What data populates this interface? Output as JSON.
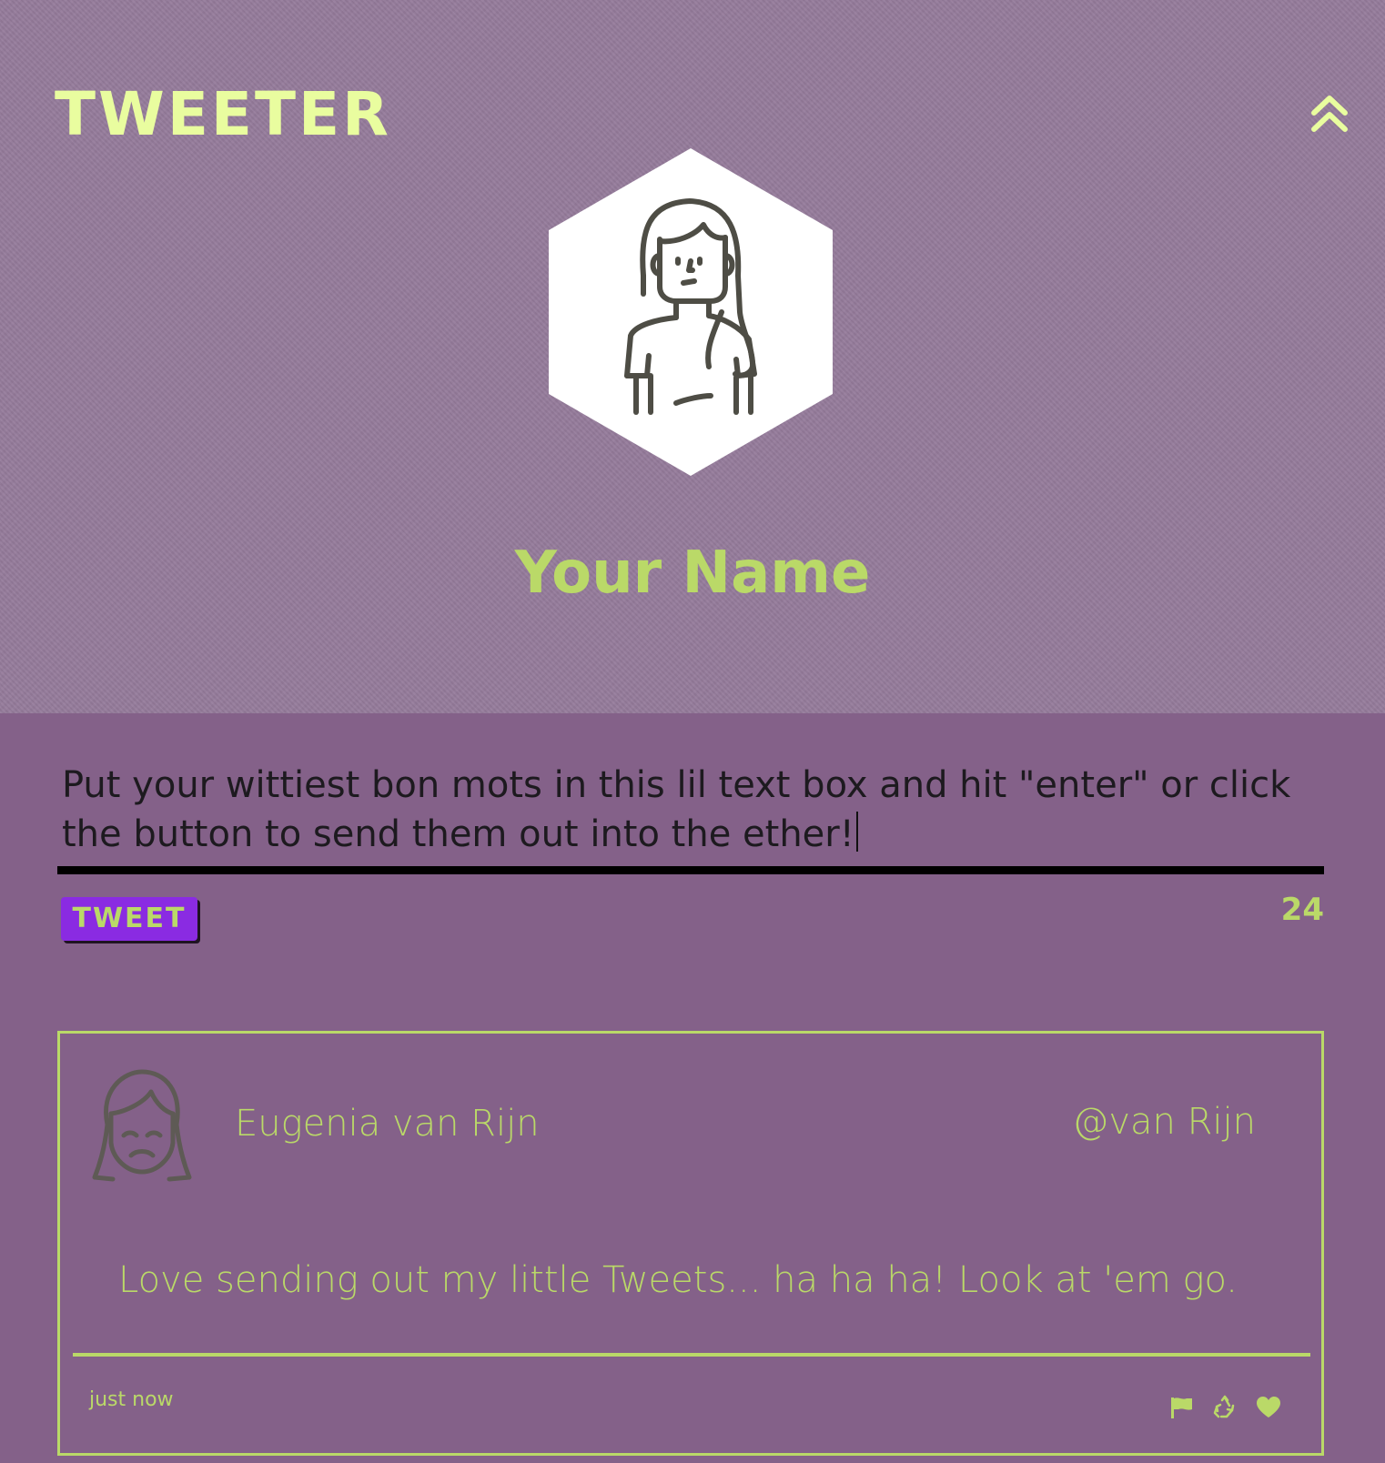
{
  "header": {
    "brand": "TWEETER",
    "user_name": "Your Name"
  },
  "composer": {
    "text": "Put your wittiest bon mots in this lil text box and hit \"enter\" or click the button to send them out into the ether!",
    "button_label": "TWEET",
    "char_count": "24"
  },
  "tweet": {
    "author": "Eugenia van Rijn",
    "handle": "@van Rijn",
    "body": "Love sending out my little Tweets... ha ha ha! Look at 'em go.",
    "time": "just now",
    "actions": [
      "flag-icon",
      "retweet-icon",
      "heart-icon"
    ]
  },
  "colors": {
    "header_bg": "#957b9b",
    "page_bg": "#846189",
    "accent": "#bad968",
    "brand": "#e9fd9f",
    "button_bg": "#8a2be2"
  }
}
